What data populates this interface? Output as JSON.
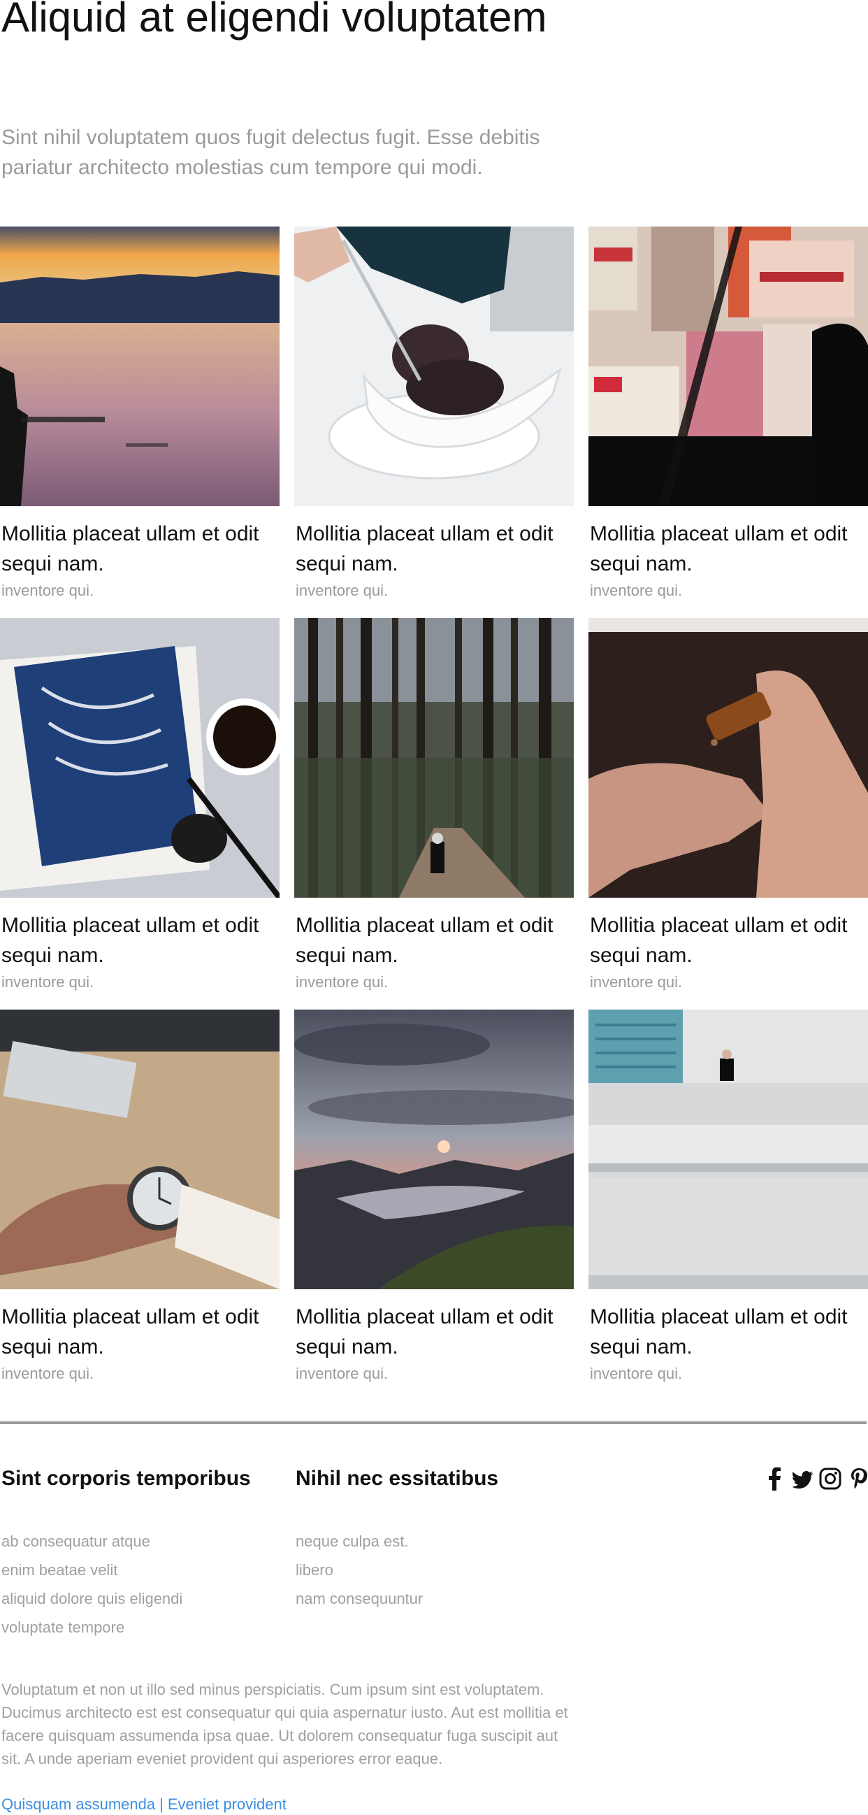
{
  "header": {
    "title": "Aliquid at eligendi voluptatem",
    "intro": "Sint nihil voluptatem quos fugit delectus fugit. Esse debitis pariatur architecto molestias cum tempore qui modi."
  },
  "cards": [
    {
      "image": "lake-sunset-photo",
      "title": "Mollitia placeat ullam et odit sequi nam.",
      "subtitle": "inventore qui."
    },
    {
      "image": "ice-cream-bowl-photo",
      "title": "Mollitia placeat ullam et odit sequi nam.",
      "subtitle": "inventore qui."
    },
    {
      "image": "poster-wall-photo",
      "title": "Mollitia placeat ullam et odit sequi nam.",
      "subtitle": "inventore qui."
    },
    {
      "image": "book-and-coffee-photo",
      "title": "Mollitia placeat ullam et odit sequi nam.",
      "subtitle": "inventore qui."
    },
    {
      "image": "forest-path-photo",
      "title": "Mollitia placeat ullam et odit sequi nam.",
      "subtitle": "inventore qui."
    },
    {
      "image": "dropper-bottle-photo",
      "title": "Mollitia placeat ullam et odit sequi nam.",
      "subtitle": "inventore qui."
    },
    {
      "image": "wrist-watch-photo",
      "title": "Mollitia placeat ullam et odit sequi nam.",
      "subtitle": "inventore qui."
    },
    {
      "image": "mountain-sunset-photo",
      "title": "Mollitia placeat ullam et odit sequi nam.",
      "subtitle": "inventore qui."
    },
    {
      "image": "rooftop-building-photo",
      "title": "Mollitia placeat ullam et odit sequi nam.",
      "subtitle": "inventore qui."
    }
  ],
  "footer": {
    "col1": {
      "title": "Sint corporis temporibus",
      "links": [
        "ab consequatur atque",
        "enim beatae velit",
        "aliquid dolore quis eligendi",
        "voluptate tempore"
      ]
    },
    "col2": {
      "title": "Nihil nec essitatibus",
      "links": [
        "neque culpa est.",
        "libero",
        "nam consequuntur"
      ]
    },
    "social": [
      "facebook-icon",
      "twitter-icon",
      "instagram-icon",
      "pinterest-icon"
    ],
    "text": "Voluptatum et non ut illo sed minus perspiciatis. Cum ipsum sint est voluptatem. Ducimus architecto est est consequatur qui quia aspernatur iusto. Aut est mollitia et facere quisquam assumenda ipsa quae. Ut dolorem consequatur fuga suscipit aut sit. A unde aperiam eveniet provident qui asperiores error eaque.",
    "link1": "Quisquam assumenda",
    "separator": "|",
    "link2": "Eveniet provident"
  },
  "colors": {
    "text": "#111111",
    "muted": "#9a9a9a",
    "link": "#3d8fe0",
    "divider": "#9b9b9b"
  }
}
